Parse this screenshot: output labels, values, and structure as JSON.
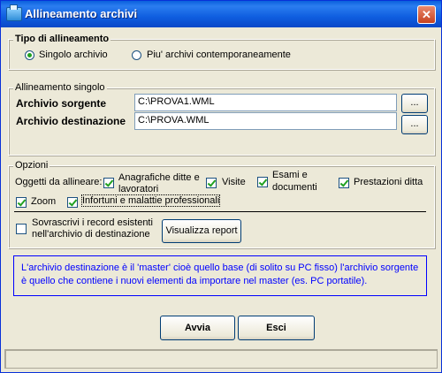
{
  "window": {
    "title": "Allineamento archivi",
    "close_label": "✕"
  },
  "tipo": {
    "legend": "Tipo di allineamento",
    "options": [
      "Singolo archivio",
      "Piu' archivi contemporaneamente"
    ],
    "selected": "Singolo archivio"
  },
  "singolo": {
    "legend": "Allineamento singolo",
    "sorgente_label": "Archivio sorgente",
    "sorgente_value": "C:\\PROVA1.WML",
    "destinazione_label": "Archivio destinazione",
    "destinazione_value": "C:\\PROVA.WML",
    "browse_label": "..."
  },
  "opzioni": {
    "legend": "Opzioni",
    "oggetti_label": "Oggetti da allineare:",
    "anagrafiche": {
      "label_line1": "Anagrafiche ditte e",
      "label_line2": "lavoratori",
      "checked": true
    },
    "visite": {
      "label": "Visite",
      "checked": true
    },
    "esami": {
      "label_line1": "Esami e",
      "label_line2": "documenti",
      "checked": true
    },
    "prestazioni": {
      "label": "Prestazioni ditta",
      "checked": true
    },
    "zoom": {
      "label": "Zoom",
      "checked": true
    },
    "infortuni": {
      "label": "Infortuni e malattie professionali",
      "checked": true
    },
    "sovrascrivi": {
      "label_line1": "Sovrascrivi i record esistenti",
      "label_line2": "nell'archivio di destinazione",
      "checked": false
    },
    "report_label": "Visualizza report"
  },
  "info_text": "L'archivio destinazione è il 'master' cioè quello base (di solito su PC fisso) l'archivio sorgente è quello che contiene i nuovi elementi da importare nel master (es. PC portatile).",
  "buttons": {
    "avvia": "Avvia",
    "esci": "Esci"
  },
  "colors": {
    "title_bar": "#0a5fdc",
    "face": "#ece9d8",
    "info_text": "#0000ff",
    "check": "#21a121"
  }
}
